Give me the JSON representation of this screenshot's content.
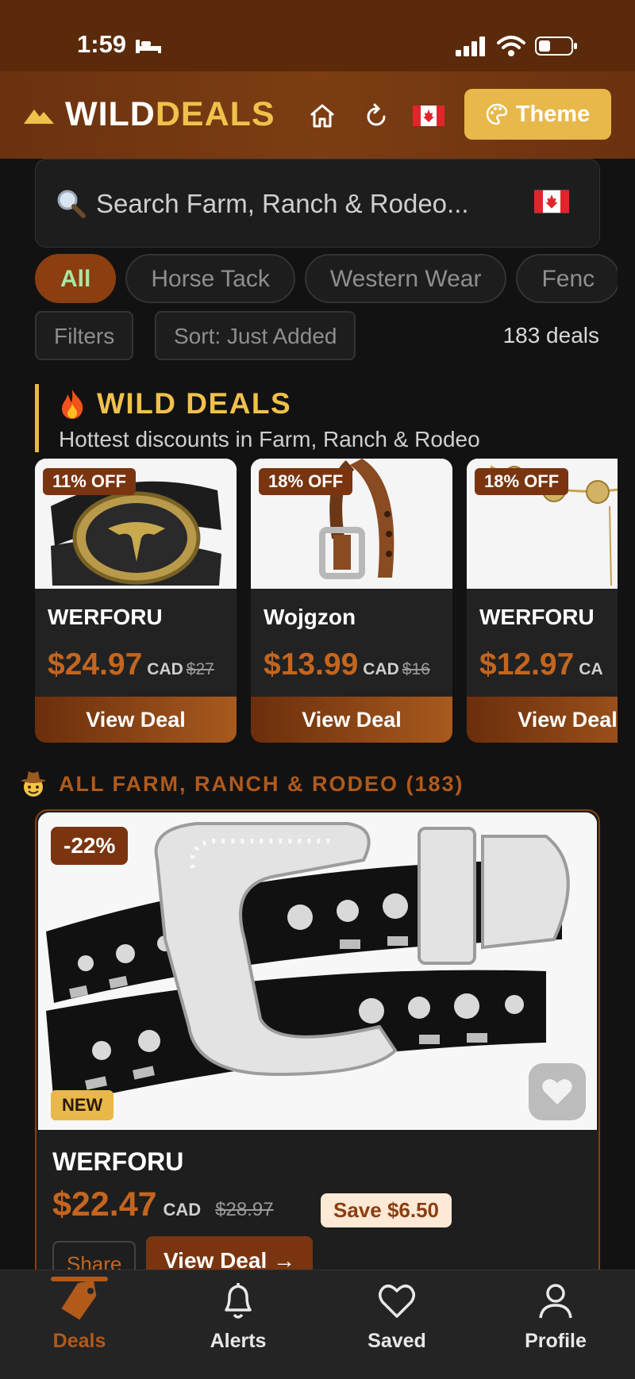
{
  "status_bar": {
    "time": "1:59"
  },
  "header": {
    "logo_wild": "WILD",
    "logo_deals": "DEALS",
    "theme_label": "Theme"
  },
  "search": {
    "placeholder": "Search Farm, Ranch & Rodeo..."
  },
  "chips": [
    "All",
    "Horse Tack",
    "Western Wear",
    "Fenc"
  ],
  "filters": {
    "filters_label": "Filters",
    "sort_label": "Sort: Just Added",
    "count": "183 deals"
  },
  "wild_deals": {
    "title": "WILD DEALS",
    "subtitle": "Hottest discounts in Farm, Ranch & Rodeo",
    "cards": [
      {
        "badge": "11% OFF",
        "brand": "WERFORU",
        "price": "$24.97",
        "currency": "CAD",
        "old_price": "$27",
        "button": "View Deal"
      },
      {
        "badge": "18% OFF",
        "brand": "Wojgzon",
        "price": "$13.99",
        "currency": "CAD",
        "old_price": "$16",
        "button": "View Deal"
      },
      {
        "badge": "18% OFF",
        "brand": "WERFORU",
        "price": "$12.97",
        "currency": "CA",
        "old_price": "",
        "button": "View Deal"
      }
    ]
  },
  "all_section": {
    "title": "ALL FARM, RANCH & RODEO (183)"
  },
  "product": {
    "discount_badge": "-22%",
    "new_badge": "NEW",
    "brand": "WERFORU",
    "price": "$22.47",
    "currency": "CAD",
    "old_price": "$28.97",
    "save": "Save $6.50",
    "share_label": "Share",
    "view_label": "View Deal →"
  },
  "tabbar": {
    "tabs": [
      {
        "label": "Deals",
        "icon": "tag-icon"
      },
      {
        "label": "Alerts",
        "icon": "bell-icon"
      },
      {
        "label": "Saved",
        "icon": "heart-icon"
      },
      {
        "label": "Profile",
        "icon": "user-icon"
      }
    ],
    "active": "Deals"
  },
  "colors": {
    "accent": "#b15a1a",
    "gold": "#f0c14b",
    "header": "#6b3210",
    "background": "#121212"
  }
}
